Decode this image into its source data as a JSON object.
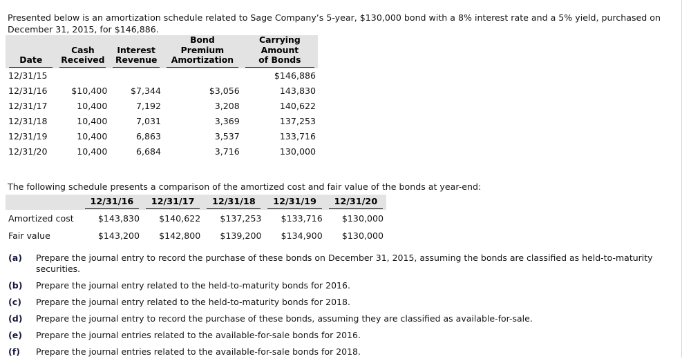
{
  "intro": {
    "text": "Presented below is an amortization schedule related to Sage Company’s 5-year, $130,000 bond with a 8% interest rate and a 5% yield, purchased on December 31, 2015, for $146,886."
  },
  "schedule_table": {
    "headers": {
      "date": "Date",
      "cash_received_line1": "Cash",
      "cash_received_line2": "Received",
      "interest_revenue_line1": "Interest",
      "interest_revenue_line2": "Revenue",
      "bond_premium_line1": "Bond",
      "bond_premium_line2": "Premium",
      "bond_premium_line3": "Amortization",
      "carrying_line1": "Carrying",
      "carrying_line2": "Amount",
      "carrying_line3": "of Bonds"
    },
    "rows": [
      {
        "date": "12/31/15",
        "cash_received": "",
        "interest_revenue": "",
        "bond_premium_amortization": "",
        "carrying_amount": "$146,886"
      },
      {
        "date": "12/31/16",
        "cash_received": "$10,400",
        "interest_revenue": "$7,344",
        "bond_premium_amortization": "$3,056",
        "carrying_amount": "143,830"
      },
      {
        "date": "12/31/17",
        "cash_received": "10,400",
        "interest_revenue": "7,192",
        "bond_premium_amortization": "3,208",
        "carrying_amount": "140,622"
      },
      {
        "date": "12/31/18",
        "cash_received": "10,400",
        "interest_revenue": "7,031",
        "bond_premium_amortization": "3,369",
        "carrying_amount": "137,253"
      },
      {
        "date": "12/31/19",
        "cash_received": "10,400",
        "interest_revenue": "6,863",
        "bond_premium_amortization": "3,537",
        "carrying_amount": "133,716"
      },
      {
        "date": "12/31/20",
        "cash_received": "10,400",
        "interest_revenue": "6,684",
        "bond_premium_amortization": "3,716",
        "carrying_amount": "130,000"
      }
    ]
  },
  "compare_intro": {
    "text": "The following schedule presents a comparison of the amortized cost and fair value of the bonds at year-end:"
  },
  "comparison_table": {
    "corner_label": "",
    "column_headers": [
      "12/31/16",
      "12/31/17",
      "12/31/18",
      "12/31/19",
      "12/31/20"
    ],
    "rows": [
      {
        "label": "Amortized cost",
        "values": [
          "$143,830",
          "$140,622",
          "$137,253",
          "$133,716",
          "$130,000"
        ]
      },
      {
        "label": "Fair value",
        "values": [
          "$143,200",
          "$142,800",
          "$139,200",
          "$134,900",
          "$130,000"
        ]
      }
    ]
  },
  "requirements": [
    {
      "marker": "(a)",
      "text": "Prepare the journal entry to record the purchase of these bonds on December 31, 2015, assuming the bonds are classified as held-to-maturity securities."
    },
    {
      "marker": "(b)",
      "text": "Prepare the journal entry related to the held-to-maturity bonds for 2016."
    },
    {
      "marker": "(c)",
      "text": "Prepare the journal entry related to the held-to-maturity bonds for 2018."
    },
    {
      "marker": "(d)",
      "text": "Prepare the journal entry to record the purchase of these bonds, assuming they are classified as available-for-sale."
    },
    {
      "marker": "(e)",
      "text": "Prepare the journal entries related to the available-for-sale bonds for 2016."
    },
    {
      "marker": "(f)",
      "text": "Prepare the journal entries related to the available-for-sale bonds for 2018."
    }
  ],
  "colors": {
    "page_background": "#ffffff",
    "table_header_background": "#e3e3e3",
    "text": "#141414",
    "marker": "#16193b",
    "rule": "#1a1a1a"
  }
}
